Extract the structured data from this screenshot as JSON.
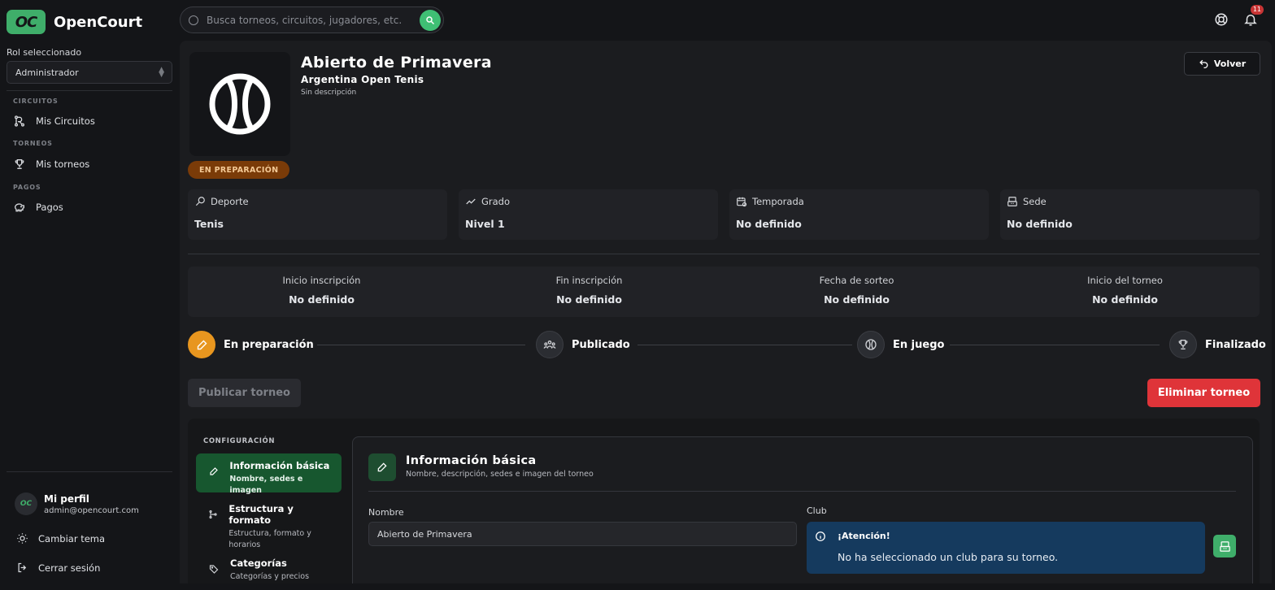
{
  "app": {
    "name": "OpenCourt",
    "logo_mark": "OC"
  },
  "search": {
    "placeholder": "Busca torneos, circuitos, jugadores, etc."
  },
  "topbar": {
    "notification_count": "11",
    "icons": [
      "support-icon",
      "bell-icon"
    ]
  },
  "sidebar": {
    "role_label": "Rol seleccionado",
    "role_value": "Administrador",
    "sections": [
      {
        "label": "CIRCUITOS",
        "items": [
          {
            "label": "Mis Circuitos",
            "icon": "circuit-icon"
          }
        ]
      },
      {
        "label": "TORNEOS",
        "items": [
          {
            "label": "Mis torneos",
            "icon": "trophy-icon"
          }
        ]
      },
      {
        "label": "PAGOS",
        "items": [
          {
            "label": "Pagos",
            "icon": "piggy-bank-icon"
          }
        ]
      }
    ],
    "profile": {
      "name": "Mi perfil",
      "email": "admin@opencourt.com",
      "avatar_text": "OC"
    },
    "bottom": [
      {
        "label": "Cambiar tema",
        "icon": "sun-icon"
      },
      {
        "label": "Cerrar sesión",
        "icon": "logout-icon"
      }
    ]
  },
  "tournament": {
    "title": "Abierto de Primavera",
    "organization": "Argentina Open Tenis",
    "description": "Sin descripción",
    "back_label": "Volver",
    "status": "EN PREPARACIÓN",
    "info_cards": [
      {
        "label": "Deporte",
        "value": "Tenis",
        "icon": "racket-icon"
      },
      {
        "label": "Grado",
        "value": "Nivel 1",
        "icon": "trend-icon"
      },
      {
        "label": "Temporada",
        "value": "No definido",
        "icon": "calendar-icon"
      },
      {
        "label": "Sede",
        "value": "No definido",
        "icon": "building-icon"
      }
    ],
    "dates": [
      {
        "label": "Inicio inscripción",
        "value": "No definido"
      },
      {
        "label": "Fin inscripción",
        "value": "No definido"
      },
      {
        "label": "Fecha de sorteo",
        "value": "No definido"
      },
      {
        "label": "Inicio del torneo",
        "value": "No definido"
      }
    ],
    "steps": [
      {
        "label": "En preparación",
        "icon": "pencil-icon",
        "active": true
      },
      {
        "label": "Publicado",
        "icon": "users-icon",
        "active": false
      },
      {
        "label": "En juego",
        "icon": "tennis-ball-icon",
        "active": false
      },
      {
        "label": "Finalizado",
        "icon": "trophy-icon",
        "active": false
      }
    ],
    "publish_label": "Publicar torneo",
    "delete_label": "Eliminar torneo"
  },
  "config": {
    "section_label": "CONFIGURACIÓN",
    "items": [
      {
        "title": "Información básica",
        "subtitle": "Nombre, sedes e imagen",
        "icon": "pencil-icon",
        "active": true
      },
      {
        "title": "Estructura y formato",
        "subtitle": "Estructura, formato y horarios",
        "icon": "bracket-icon",
        "active": false
      },
      {
        "title": "Categorías",
        "subtitle": "Categorías y precios",
        "icon": "tag-icon",
        "active": false
      }
    ],
    "panel": {
      "title": "Información básica",
      "subtitle": "Nombre, descripción, sedes e imagen del torneo",
      "name_label": "Nombre",
      "name_value": "Abierto de Primavera",
      "club_label": "Club",
      "alert_title": "¡Atención!",
      "alert_text": "No ha seleccionado un club para su torneo."
    }
  },
  "colors": {
    "brand": "#3fae6a",
    "status_orange": "#e8961f",
    "danger": "#df3439",
    "alert_blue": "#153a5e",
    "active_nav": "#17572f"
  }
}
